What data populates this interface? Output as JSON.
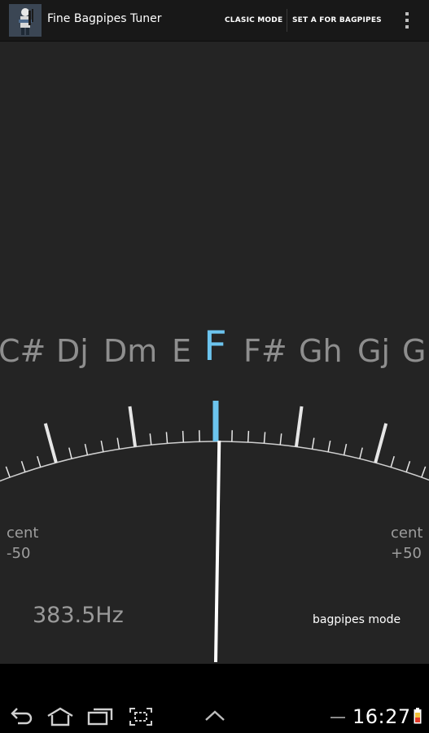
{
  "action_bar": {
    "app_icon": "bagpiper-app-icon",
    "title": "Fine Bagpipes Tuner",
    "clasic_mode_label": "CLASIC MODE",
    "set_a_label": "SET A FOR BAGPIPES",
    "overflow_icon": "overflow-menu-icon"
  },
  "tuner": {
    "notes_left": [
      "C#",
      "Dj",
      "Dm",
      "E"
    ],
    "current_note": "F",
    "notes_right": [
      "F#",
      "Gh",
      "Gj",
      "G"
    ],
    "current_note_color": "#6cc4ee",
    "other_note_color": "#8e8e8e",
    "needle_cents": 0,
    "cent_min_label": "cent",
    "cent_min_value": "-50",
    "cent_max_label": "cent",
    "cent_max_value": "+50",
    "frequency": "383.5Hz",
    "mode": "bagpipes mode"
  },
  "system_bar": {
    "back_icon": "back-icon",
    "home_icon": "home-icon",
    "recents_icon": "recent-apps-icon",
    "screenshot_icon": "screenshot-icon",
    "up_icon": "chevron-up-icon",
    "time": "16:27",
    "battery_icon": "battery-icon"
  }
}
